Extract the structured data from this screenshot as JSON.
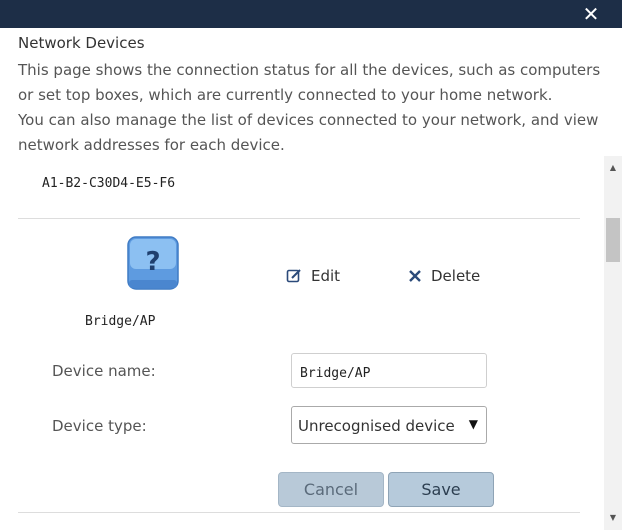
{
  "header": {
    "close_glyph": "✕"
  },
  "heading": "Network Devices",
  "intro": {
    "line1": "This page shows the connection status for all the devices, such as computers or set top boxes, which are currently connected to your home network.",
    "line2": "You can also manage the list of devices connected to your network, and view network addresses for each device."
  },
  "device": {
    "mac": "A1-B2-C30D4-E5-F6",
    "icon_glyph": "?",
    "label": "Bridge/AP",
    "edit_label": "Edit",
    "delete_label": "Delete"
  },
  "form": {
    "name_label": "Device name:",
    "name_value": "Bridge/AP",
    "type_label": "Device type:",
    "type_value": "Unrecognised device",
    "cancel_label": "Cancel",
    "save_label": "Save"
  },
  "colors": {
    "titlebar": "#1d2e47",
    "icon_blue": "#6aa8e8",
    "button_blue": "#b6cadb",
    "delete_x": "#2b4a7a"
  }
}
